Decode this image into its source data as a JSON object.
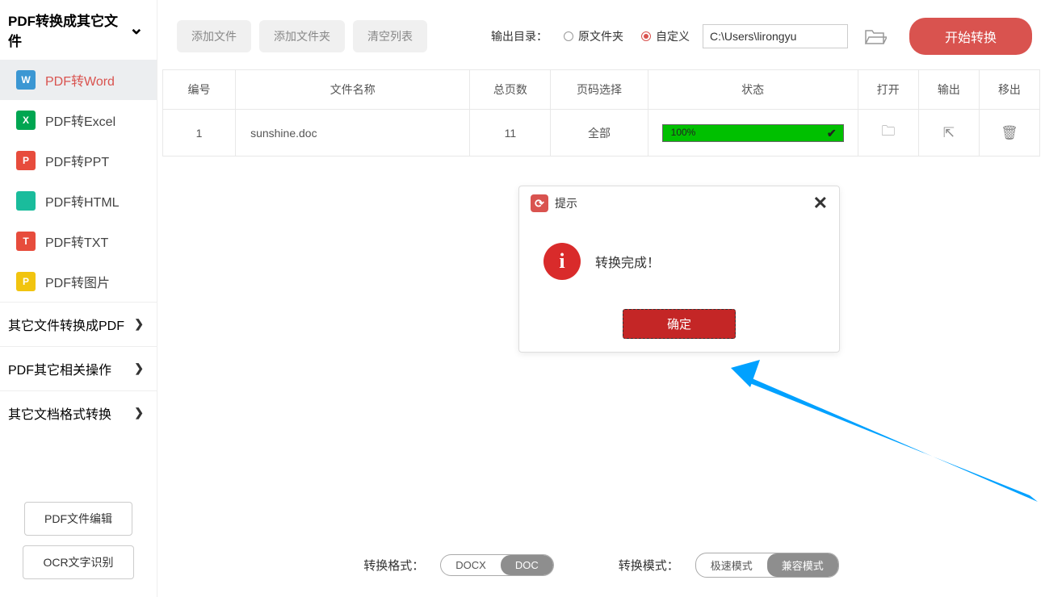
{
  "sidebar": {
    "header": "PDF转换成其它文件",
    "items": [
      {
        "icon": "W",
        "label": "PDF转Word",
        "active": true,
        "cls": "ic-w"
      },
      {
        "icon": "X",
        "label": "PDF转Excel",
        "active": false,
        "cls": "ic-x"
      },
      {
        "icon": "P",
        "label": "PDF转PPT",
        "active": false,
        "cls": "ic-p"
      },
      {
        "icon": "</>",
        "label": "PDF转HTML",
        "active": false,
        "cls": "ic-h"
      },
      {
        "icon": "T",
        "label": "PDF转TXT",
        "active": false,
        "cls": "ic-t"
      },
      {
        "icon": "P",
        "label": "PDF转图片",
        "active": false,
        "cls": "ic-i"
      }
    ],
    "sections": [
      "其它文件转换成PDF",
      "PDF其它相关操作",
      "其它文档格式转换"
    ],
    "bottom": {
      "edit": "PDF文件编辑",
      "ocr": "OCR文字识别"
    }
  },
  "toolbar": {
    "add_file": "添加文件",
    "add_folder": "添加文件夹",
    "clear_list": "清空列表",
    "output_label": "输出目录：",
    "radio_orig": "原文件夹",
    "radio_custom": "自定义",
    "path_value": "C:\\Users\\lirongyu",
    "start": "开始转换"
  },
  "table": {
    "headers": {
      "id": "编号",
      "name": "文件名称",
      "pages": "总页数",
      "range": "页码选择",
      "status": "状态",
      "open": "打开",
      "export": "输出",
      "remove": "移出"
    },
    "rows": [
      {
        "id": "1",
        "name": "sunshine.doc",
        "pages": "11",
        "range": "全部",
        "progress": "100%"
      }
    ]
  },
  "dialog": {
    "title": "提示",
    "message": "转换完成！",
    "ok": "确定"
  },
  "bottom": {
    "format_label": "转换格式：",
    "format_docx": "DOCX",
    "format_doc": "DOC",
    "mode_label": "转换模式：",
    "mode_fast": "极速模式",
    "mode_compat": "兼容模式"
  }
}
